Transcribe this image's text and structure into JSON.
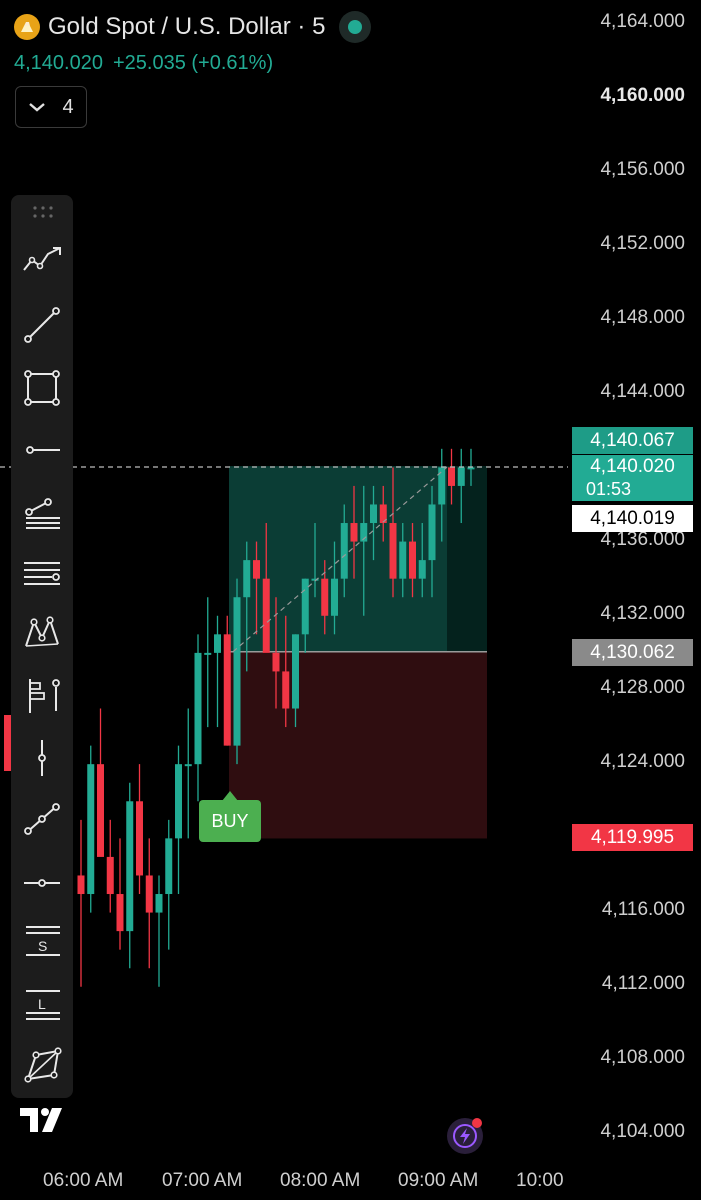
{
  "header": {
    "symbol_title": "Gold Spot / U.S. Dollar · 5",
    "last_price": "4,140.020",
    "change": "+25.035 (+0.61%)",
    "indicator_count": "4"
  },
  "colors": {
    "up": "#22ab94",
    "down": "#f23645",
    "profit_zone": "#0b3d35",
    "loss_zone": "#2f0d10",
    "buy_button": "#4caf50"
  },
  "price_axis": {
    "labels": [
      "4,164.000",
      "4,160.000",
      "4,156.000",
      "4,152.000",
      "4,148.000",
      "4,144.000",
      "4,136.000",
      "4,132.000",
      "4,128.000",
      "4,124.000",
      "4,116.000",
      "4,112.000",
      "4,108.000",
      "4,104.000"
    ],
    "bold_label": "4,160.000"
  },
  "price_tags": {
    "target": "4,140.067",
    "current": "4,140.020",
    "countdown": "01:53",
    "cursor": "4,140.019",
    "entry": "4,130.062",
    "stop": "4,119.995"
  },
  "time_axis": [
    "06:00 AM",
    "07:00 AM",
    "08:00 AM",
    "09:00 AM",
    "10:00"
  ],
  "position": {
    "label": "BUY",
    "entry": 4130.062,
    "target": 4140.067,
    "stop": 4119.995
  },
  "toolbar": {
    "items": [
      {
        "name": "trend-line-tools-icon"
      },
      {
        "name": "line-tool-icon"
      },
      {
        "name": "rectangle-tool-icon"
      },
      {
        "name": "horizontal-ray-icon"
      },
      {
        "name": "fib-retracement-icon"
      },
      {
        "name": "parallel-lines-icon"
      },
      {
        "name": "pattern-tool-icon"
      },
      {
        "name": "prediction-tool-icon"
      },
      {
        "name": "vertical-line-icon"
      },
      {
        "name": "ruler-tool-icon"
      },
      {
        "name": "horizontal-line-icon"
      },
      {
        "name": "short-position-icon"
      },
      {
        "name": "long-position-icon"
      },
      {
        "name": "abcd-pattern-icon"
      }
    ]
  },
  "chart_data": {
    "type": "candlestick",
    "y_range": [
      4101.0,
      4166.0
    ],
    "candles": [
      [
        4118,
        4121,
        4112,
        4117
      ],
      [
        4117,
        4125,
        4116,
        4124
      ],
      [
        4124,
        4127,
        4120,
        4119
      ],
      [
        4119,
        4121,
        4116,
        4117
      ],
      [
        4117,
        4120,
        4114,
        4115
      ],
      [
        4115,
        4123,
        4113,
        4122
      ],
      [
        4122,
        4124,
        4117,
        4118
      ],
      [
        4118,
        4120,
        4113,
        4116
      ],
      [
        4116,
        4118,
        4112,
        4117
      ],
      [
        4117,
        4121,
        4114,
        4120
      ],
      [
        4120,
        4125,
        4117,
        4124
      ],
      [
        4124,
        4127,
        4120,
        4124
      ],
      [
        4124,
        4131,
        4122,
        4130
      ],
      [
        4130,
        4133,
        4126,
        4130
      ],
      [
        4130,
        4132,
        4126,
        4131
      ],
      [
        4131,
        4132,
        4125,
        4125
      ],
      [
        4125,
        4134,
        4124,
        4133
      ],
      [
        4133,
        4136,
        4129,
        4135
      ],
      [
        4135,
        4136,
        4131,
        4134
      ],
      [
        4134,
        4137,
        4132,
        4130
      ],
      [
        4130,
        4133,
        4127,
        4129
      ],
      [
        4129,
        4132,
        4126,
        4127
      ],
      [
        4127,
        4131,
        4126,
        4131
      ],
      [
        4131,
        4134,
        4130,
        4134
      ],
      [
        4134,
        4137,
        4133,
        4134
      ],
      [
        4134,
        4135,
        4131,
        4132
      ],
      [
        4132,
        4136,
        4131,
        4134
      ],
      [
        4134,
        4138,
        4133,
        4137
      ],
      [
        4137,
        4139,
        4134,
        4136
      ],
      [
        4136,
        4139,
        4132,
        4137
      ],
      [
        4137,
        4139,
        4135,
        4138
      ],
      [
        4138,
        4139,
        4136,
        4137
      ],
      [
        4137,
        4140,
        4133,
        4134
      ],
      [
        4134,
        4137,
        4133,
        4136
      ],
      [
        4136,
        4137,
        4133,
        4134
      ],
      [
        4134,
        4137,
        4133,
        4135
      ],
      [
        4135,
        4139,
        4133,
        4138
      ],
      [
        4138,
        4141,
        4136,
        4140
      ],
      [
        4140,
        4141,
        4138,
        4139
      ],
      [
        4139,
        4141,
        4137,
        4140
      ],
      [
        4140,
        4141,
        4139,
        4140
      ]
    ]
  }
}
